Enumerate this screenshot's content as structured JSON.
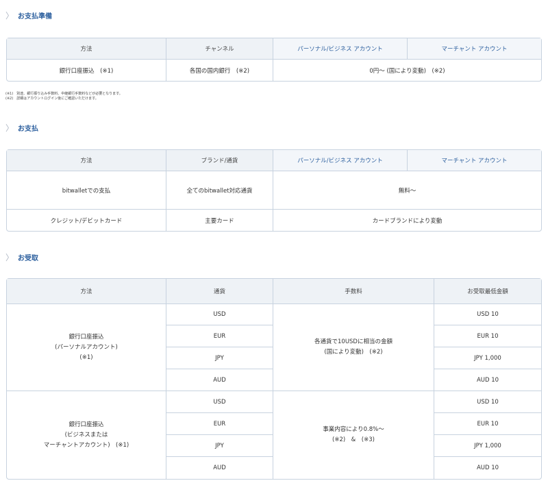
{
  "sections": {
    "prep": {
      "title": "お支払準備",
      "headers": [
        "方法",
        "チャンネル",
        "パーソナル/ビジネス アカウント",
        "マーチャント アカウント"
      ],
      "row": {
        "method": "銀行口座振込　(※1)",
        "channel": "各国の国内銀行　(※2)",
        "fee": "0円〜 (国により変動)　(※2)"
      },
      "notes": [
        "(※1)　別途、銀行振り込み手数料、中継銀行手数料などが必要となります。",
        "(※2)　詳細はアカウントログイン後にご確認いただけます。"
      ]
    },
    "payment": {
      "title": "お支払",
      "headers": [
        "方法",
        "ブランド/通貨",
        "パーソナル/ビジネス アカウント",
        "マーチャント アカウント"
      ],
      "rows": [
        {
          "method": "bitwalletでの支払",
          "brand": "全てのbitwallet対応通貨",
          "fee": "無料〜"
        },
        {
          "method": "クレジット/デビットカード",
          "brand": "主要カード",
          "fee": "カードブランドにより変動"
        }
      ]
    },
    "receive": {
      "title": "お受取",
      "headers": [
        "方法",
        "通貨",
        "手数料",
        "お受取最低金額"
      ],
      "group1": {
        "method_line1": "銀行口座振込",
        "method_line2": "(パーソナルアカウント)",
        "method_line3": "(※1)",
        "fee_line1": "各通貨で10USDに相当の金額",
        "fee_line2": "(国により変動)　(※2)",
        "rows": [
          {
            "currency": "USD",
            "min": "USD 10"
          },
          {
            "currency": "EUR",
            "min": "EUR 10"
          },
          {
            "currency": "JPY",
            "min": "JPY 1,000"
          },
          {
            "currency": "AUD",
            "min": "AUD 10"
          }
        ]
      },
      "group2": {
        "method_line1": "銀行口座振込",
        "method_line2": "(ビジネスまたは",
        "method_line3": "マーチャントアカウント)　(※1)",
        "fee_line1": "事業内容により0.8%〜",
        "fee_line2": "(※2)　&　(※3)",
        "rows": [
          {
            "currency": "USD",
            "min": "USD 10"
          },
          {
            "currency": "EUR",
            "min": "EUR 10"
          },
          {
            "currency": "JPY",
            "min": "JPY 1,000"
          },
          {
            "currency": "AUD",
            "min": "AUD 10"
          }
        ]
      }
    }
  }
}
